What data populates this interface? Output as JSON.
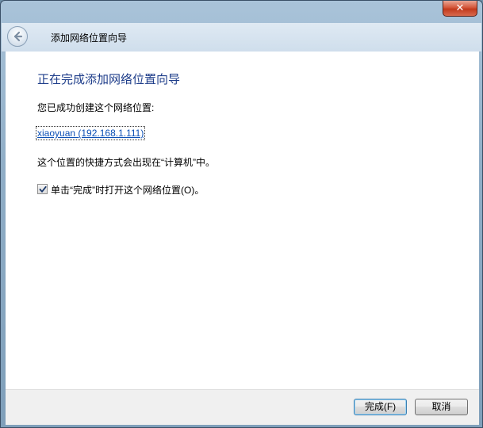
{
  "window": {
    "close_glyph": "✕"
  },
  "nav": {
    "back_icon": "back-arrow-icon",
    "title": "添加网络位置向导"
  },
  "content": {
    "heading": "正在完成添加网络位置向导",
    "created_text": "您已成功创建这个网络位置:",
    "location_link": "xiaoyuan (192.168.1.111)",
    "shortcut_text": "这个位置的快捷方式会出现在“计算机”中。",
    "checkbox_label": "单击“完成”时打开这个网络位置(O)。",
    "checkbox_checked": true
  },
  "footer": {
    "finish_label": "完成(F)",
    "cancel_label": "取消"
  },
  "colors": {
    "heading": "#1e3d8a",
    "link": "#0b4fb5",
    "close_button": "#c23a1d"
  }
}
